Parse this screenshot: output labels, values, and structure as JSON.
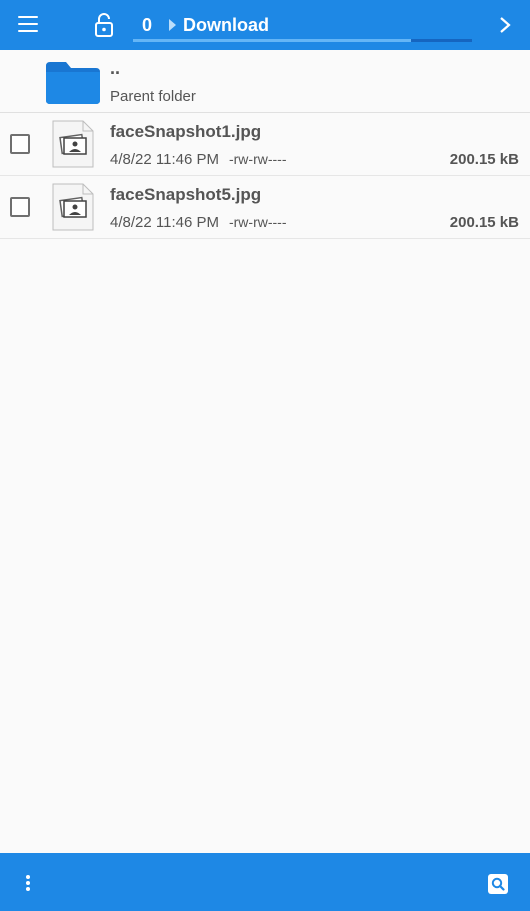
{
  "header": {
    "count": "0",
    "breadcrumb": "Download",
    "progress_fraction": 0.82,
    "icons": [
      "hamburger-menu-icon",
      "unlock-icon",
      "chevron-right-icon"
    ]
  },
  "parent_row": {
    "name": "..",
    "label": "Parent folder",
    "icon": "folder-icon",
    "color": "#1976d2"
  },
  "files": [
    {
      "name": "faceSnapshot1.jpg",
      "date": "4/8/22 11:46 PM",
      "permissions": "-rw-rw----",
      "size": "200.15 kB",
      "icon": "image-file-icon"
    },
    {
      "name": "faceSnapshot5.jpg",
      "date": "4/8/22 11:46 PM",
      "permissions": "-rw-rw----",
      "size": "200.15 kB",
      "icon": "image-file-icon"
    }
  ],
  "footer": {
    "icons": [
      "more-vert-icon",
      "search-icon"
    ]
  },
  "colors": {
    "accent": "#1e88e5",
    "progress_track": "#1565c0",
    "progress_fill": "#64b5f6",
    "background": "#fafafa"
  }
}
